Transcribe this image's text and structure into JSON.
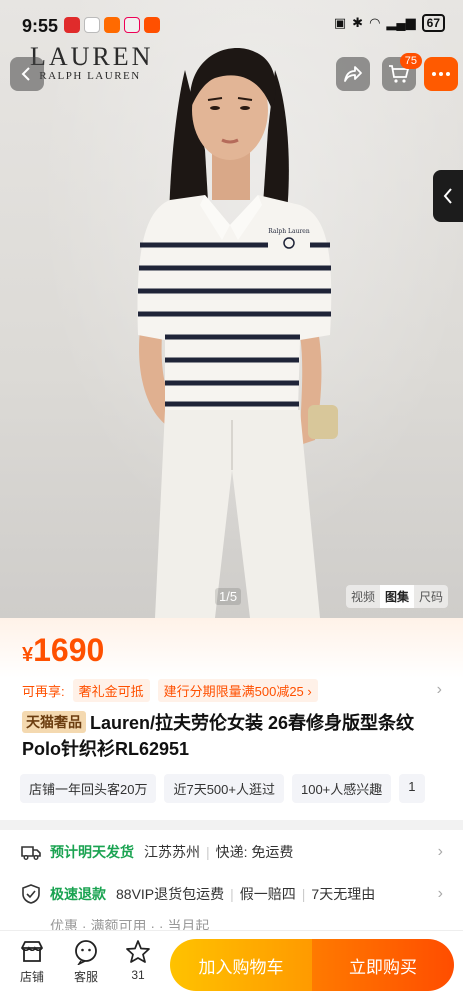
{
  "status_bar": {
    "time": "9:55",
    "battery": "67"
  },
  "hero": {
    "brand_logo_main": "LAUREN",
    "brand_logo_sub": "RALPH LAUREN",
    "cart_count": "75",
    "page_indicator": "1/5",
    "media_tabs": [
      "视频",
      "图集",
      "尺码"
    ],
    "active_media_tab": "图集",
    "shirt_logo_text": "Ralph Lauren"
  },
  "price": {
    "currency": "¥",
    "amount": "1690"
  },
  "coupons": {
    "prefix": "可再享:",
    "tags": [
      "奢礼金可抵",
      "建行分期限量满500减25"
    ]
  },
  "product": {
    "badge": "天猫奢品",
    "title": "Lauren/拉夫劳伦女装 26春修身版型条纹Polo针织衫RL62951"
  },
  "tags": [
    "店铺一年回头客20万",
    "近7天500+人逛过",
    "100+人感兴趣",
    "1"
  ],
  "services": {
    "shipping": {
      "highlight": "预计明天发货",
      "location": "江苏苏州",
      "fee": "快递: 免运费"
    },
    "refund": {
      "highlight": "极速退款",
      "items": [
        "88VIP退货包运费",
        "假一赔四",
        "7天无理由"
      ]
    },
    "partial_row": "优惠  ·  满额可用  ·  ·  当月起"
  },
  "bottom_bar": {
    "store": "店铺",
    "service": "客服",
    "fav_count": "31",
    "add_to_cart": "加入购物车",
    "buy_now": "立即购买"
  },
  "colors": {
    "accent": "#ff5000",
    "green": "#1aa351",
    "cart_button": "#ffb000",
    "buy_button": "#ff5a00"
  }
}
